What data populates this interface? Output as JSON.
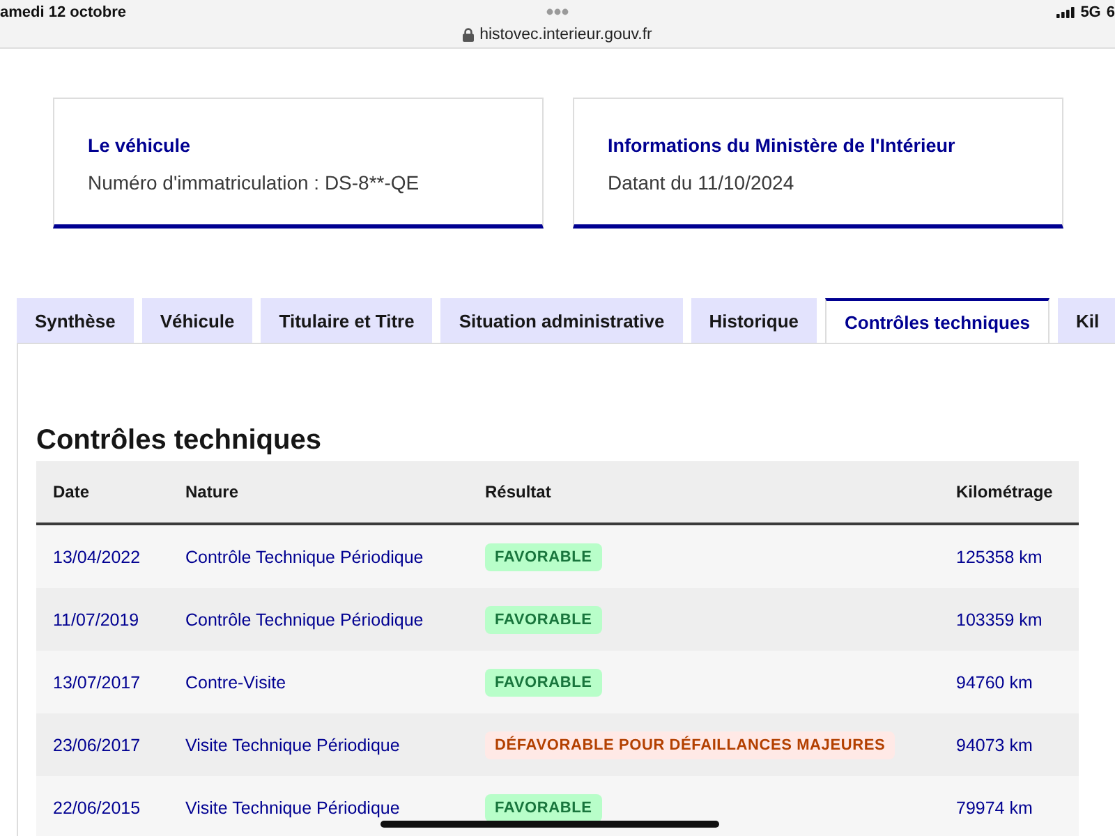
{
  "status_bar": {
    "date": "amedi 12 octobre",
    "url": "histovec.interieur.gouv.fr",
    "network": "5G",
    "battery": "6"
  },
  "cards": [
    {
      "title": "Le véhicule",
      "text": "Numéro d'immatriculation : DS-8**-QE"
    },
    {
      "title": "Informations du Ministère de l'Intérieur",
      "text": "Datant du 11/10/2024"
    }
  ],
  "tabs": [
    {
      "label": "Synthèse",
      "selected": false
    },
    {
      "label": "Véhicule",
      "selected": false
    },
    {
      "label": "Titulaire et Titre",
      "selected": false
    },
    {
      "label": "Situation administrative",
      "selected": false
    },
    {
      "label": "Historique",
      "selected": false
    },
    {
      "label": "Contrôles techniques",
      "selected": true
    },
    {
      "label": "Kil",
      "selected": false
    }
  ],
  "section": {
    "title": "Contrôles techniques",
    "table": {
      "columns": [
        "Date",
        "Nature",
        "Résultat",
        "Kilométrage"
      ],
      "rows": [
        {
          "date": "13/04/2022",
          "nature": "Contrôle Technique Périodique",
          "result": {
            "label": "FAVORABLE",
            "kind": "favorable"
          },
          "mileage": "125358 km"
        },
        {
          "date": "11/07/2019",
          "nature": "Contrôle Technique Périodique",
          "result": {
            "label": "FAVORABLE",
            "kind": "favorable"
          },
          "mileage": "103359 km"
        },
        {
          "date": "13/07/2017",
          "nature": "Contre-Visite",
          "result": {
            "label": "FAVORABLE",
            "kind": "favorable"
          },
          "mileage": "94760 km"
        },
        {
          "date": "23/06/2017",
          "nature": "Visite Technique Périodique",
          "result": {
            "label": "DÉFAVORABLE POUR DÉFAILLANCES MAJEURES",
            "kind": "defavorable"
          },
          "mileage": "94073 km"
        },
        {
          "date": "22/06/2015",
          "nature": "Visite Technique Périodique",
          "result": {
            "label": "FAVORABLE",
            "kind": "favorable"
          },
          "mileage": "79974 km"
        }
      ]
    }
  }
}
